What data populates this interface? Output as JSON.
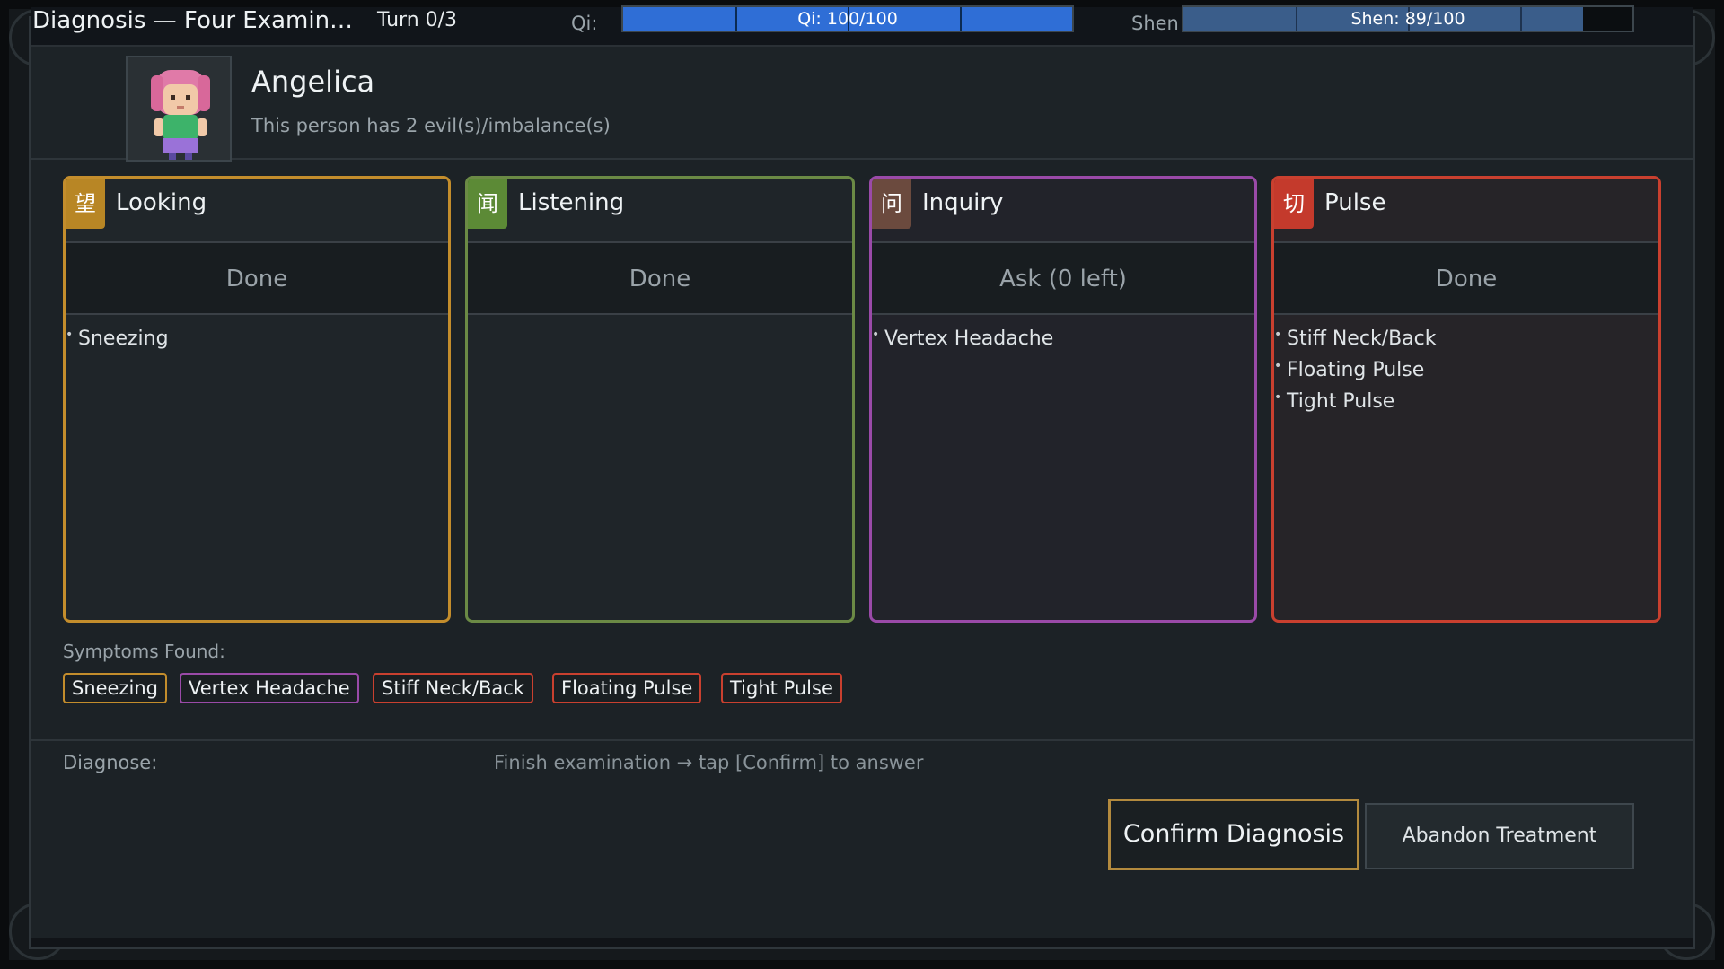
{
  "topbar": {
    "title": "Diagnosis — Four Examin…",
    "turn": "Turn 0/3",
    "qi_label": "Qi:",
    "qi_text": "Qi: 100/100",
    "qi_fraction": 1.0,
    "shen_label": "Shen",
    "shen_text": "Shen: 89/100",
    "shen_fraction": 0.89
  },
  "patient": {
    "name": "Angelica",
    "description": "This person has 2 evil(s)/imbalance(s)"
  },
  "cards": [
    {
      "glyph": "望",
      "title": "Looking",
      "action": "Done",
      "items": [
        "Sneezing"
      ]
    },
    {
      "glyph": "闻",
      "title": "Listening",
      "action": "Done",
      "items": []
    },
    {
      "glyph": "问",
      "title": "Inquiry",
      "action": "Ask (0 left)",
      "items": [
        "Vertex Headache"
      ]
    },
    {
      "glyph": "切",
      "title": "Pulse",
      "action": "Done",
      "items": [
        "Stiff Neck/Back",
        "Floating Pulse",
        "Tight Pulse"
      ]
    }
  ],
  "symptoms": {
    "label": "Symptoms Found:",
    "chips": [
      "Sneezing",
      "Vertex Headache",
      "Stiff Neck/Back",
      "Floating Pulse",
      "Tight Pulse"
    ]
  },
  "diagnose": {
    "label": "Diagnose:",
    "hint": "Finish examination → tap [Confirm] to answer"
  },
  "buttons": {
    "confirm": "Confirm Diagnosis",
    "abandon": "Abandon Treatment"
  },
  "colors": {
    "looking": "#c38d2c",
    "listening": "#6b8a45",
    "inquiry": "#9a4aa8",
    "pulse": "#c9402f",
    "qi_fill": "#2f6ed6",
    "confirm_border": "#b38a3e"
  }
}
